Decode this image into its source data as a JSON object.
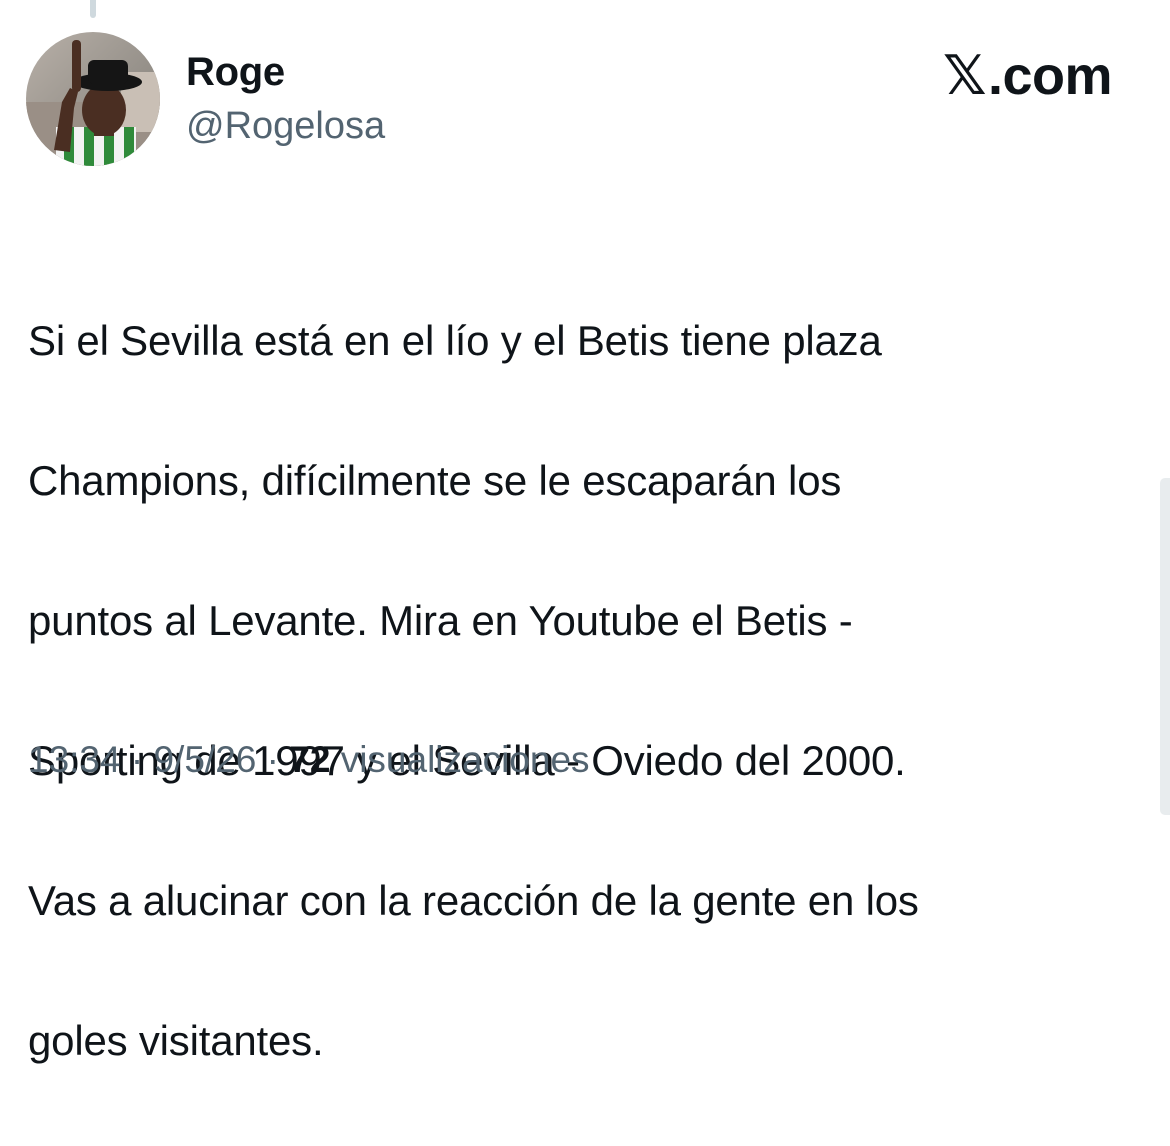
{
  "author": {
    "display_name": "Roge",
    "handle": "@Rogelosa"
  },
  "brand": {
    "mark": "𝕏",
    "suffix": ".com"
  },
  "tweet": {
    "text_lines": [
      "Si el Sevilla está en el lío y el Betis tiene plaza",
      "Champions, difícilmente se le escaparán los",
      "puntos al Levante. Mira en Youtube el Betis -",
      "Sporting de 1997 y el Sevilla - Oviedo del 2000.",
      "Vas a alucinar con la reacción de la gente en los",
      "goles visitantes."
    ]
  },
  "meta": {
    "time": "13:34",
    "separator": "·",
    "date": "9/5/26",
    "views_count": "72",
    "views_label": "visualizaciones"
  },
  "colors": {
    "text_primary": "#0f1419",
    "text_secondary": "#536471",
    "background": "#ffffff"
  }
}
